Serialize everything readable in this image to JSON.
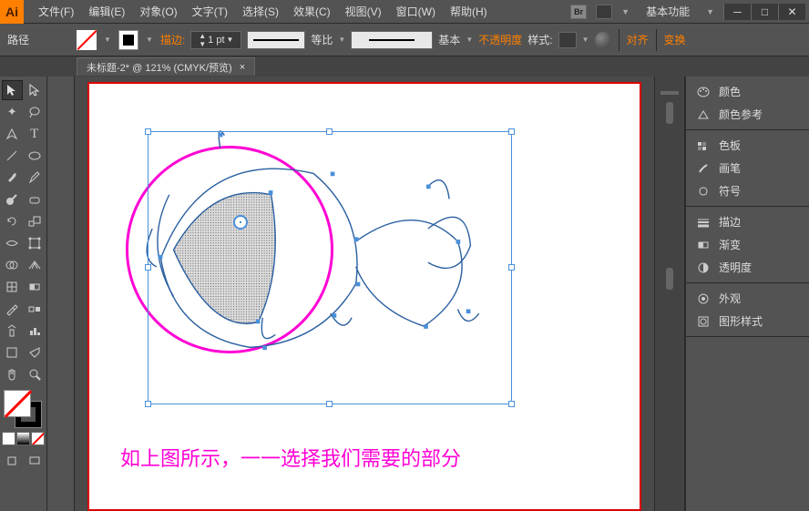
{
  "titlebar": {
    "logo": "Ai",
    "workspace": "基本功能"
  },
  "menu": {
    "file": "文件(F)",
    "edit": "编辑(E)",
    "object": "对象(O)",
    "type": "文字(T)",
    "select": "选择(S)",
    "effect": "效果(C)",
    "view": "视图(V)",
    "window": "窗口(W)",
    "help": "帮助(H)"
  },
  "controlbar": {
    "context": "路径",
    "stroke_label": "描边:",
    "stroke_weight": "1 pt",
    "profile_label": "等比",
    "brush_label": "基本",
    "opacity_label": "不透明度",
    "style_label": "样式:",
    "align_label": "对齐",
    "transform_label": "变换"
  },
  "tab": {
    "title": "未标题-2* @ 121% (CMYK/预览)"
  },
  "canvas": {
    "caption": "如上图所示，一一选择我们需要的部分"
  },
  "panels": {
    "color": "颜色",
    "color_guide": "颜色参考",
    "swatches": "色板",
    "brushes": "画笔",
    "symbols": "符号",
    "stroke": "描边",
    "gradient": "渐变",
    "transparency": "透明度",
    "appearance": "外观",
    "graphic_styles": "图形样式"
  }
}
